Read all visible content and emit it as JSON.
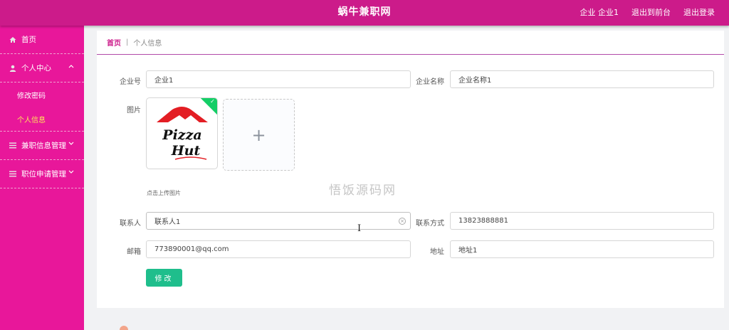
{
  "header": {
    "title": "蜗牛兼职网",
    "user_label": "企业 企业1",
    "back_label": "退出到前台",
    "logout_label": "退出登录"
  },
  "sidebar": {
    "home": "首页",
    "personal_center": "个人中心",
    "change_password": "修改密码",
    "personal_info": "个人信息",
    "job_info_mgmt": "兼职信息管理",
    "application_mgmt": "职位申请管理"
  },
  "breadcrumb": {
    "home": "首页",
    "separator": "|",
    "current": "个人信息"
  },
  "form": {
    "company_no_label": "企业号",
    "company_no_value": "企业1",
    "company_name_label": "企业名称",
    "company_name_value": "企业名称1",
    "image_label": "图片",
    "image_logo_line1": "Pizza",
    "image_logo_line2": "Hut",
    "upload_plus": "+",
    "upload_hint": "点击上传图片",
    "contact_label": "联系人",
    "contact_value": "联系人1",
    "phone_label": "联系方式",
    "phone_value": "13823888881",
    "email_label": "邮箱",
    "email_value": "773890001@qq.com",
    "address_label": "地址",
    "address_value": "地址1",
    "submit_label": "修改"
  },
  "watermark": "悟饭源码网",
  "colors": {
    "topbar": "#cc1b8a",
    "sidebar": "#e8179a",
    "active_menu": "#ffe25a",
    "submit": "#1fbe8c",
    "success_badge": "#13ce66"
  }
}
